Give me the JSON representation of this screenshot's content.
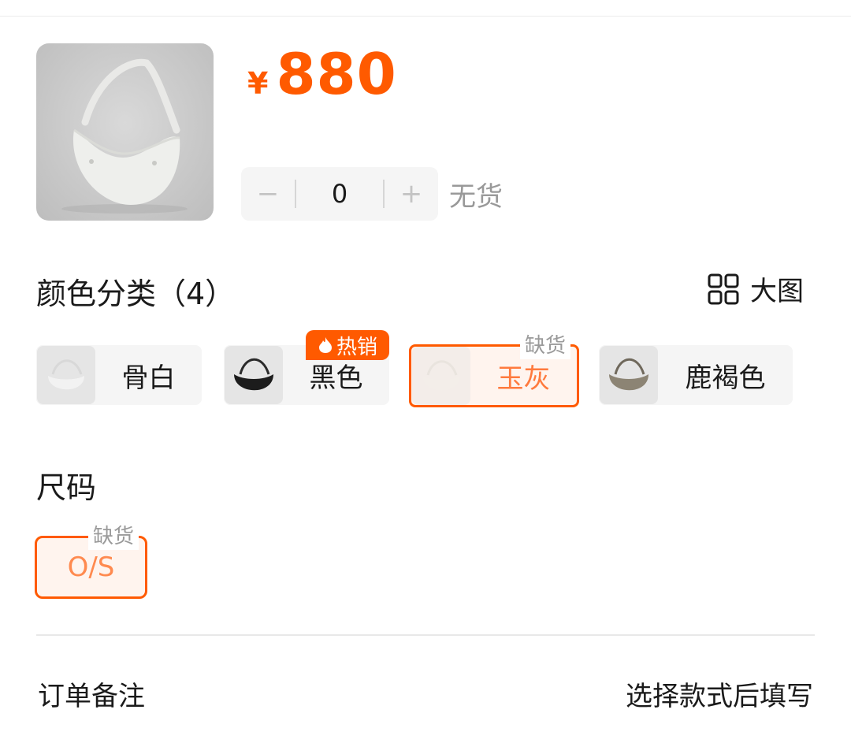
{
  "product": {
    "currency_symbol": "¥",
    "price": "880",
    "image_icon": "crescent-bag-image"
  },
  "quantity": {
    "minus_label": "−",
    "value": "0",
    "plus_label": "+",
    "stock_status": "无货"
  },
  "color": {
    "title": "颜色分类（4）",
    "big_image_label": "大图",
    "big_image_icon": "grid-icon",
    "options": [
      {
        "label": "骨白",
        "swatch": "#f2f2f2",
        "strap": "#d8d8d8"
      },
      {
        "label": "黑色",
        "swatch": "#1c1c1c",
        "strap": "#2a2a2a",
        "badge": "热销",
        "badge_icon": "flame-icon"
      },
      {
        "label": "玉灰",
        "swatch": "#e6e8e4",
        "strap": "#cfd2cc",
        "badge": "缺货",
        "selected": true
      },
      {
        "label": "鹿褐色",
        "swatch": "#8c8474",
        "strap": "#6f685b"
      }
    ]
  },
  "size": {
    "title": "尺码",
    "options": [
      {
        "label": "O/S",
        "badge": "缺货",
        "selected": true
      }
    ]
  },
  "order_note": {
    "label": "订单备注",
    "value": "选择款式后填写"
  },
  "colors": {
    "accent": "#ff5a00",
    "muted_text": "#999999"
  }
}
